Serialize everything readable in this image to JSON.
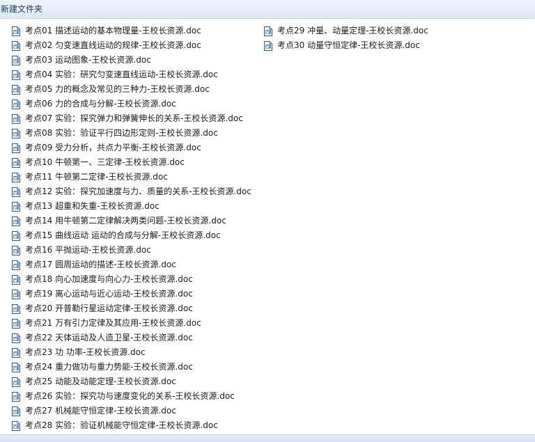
{
  "window": {
    "title": "新建文件夹"
  },
  "icon": {
    "name": "word-document-icon",
    "color": "#2b5797",
    "accent": "#5b8fd6"
  },
  "files_column_1": [
    {
      "name": "考点01 描述运动的基本物理量-王校长资源.doc"
    },
    {
      "name": "考点02 匀变速直线运动的规律-王校长资源.doc"
    },
    {
      "name": "考点03 运动图象-王校长资源.doc"
    },
    {
      "name": "考点04 实验：研究匀变速直线运动-王校长资源.doc"
    },
    {
      "name": "考点05 力的概念及常见的三种力-王校长资源.doc"
    },
    {
      "name": "考点06 力的合成与分解-王校长资源.doc"
    },
    {
      "name": "考点07 实验：探究弹力和弹簧伸长的关系-王校长资源.doc"
    },
    {
      "name": "考点08 实验：验证平行四边形定则-王校长资源.doc"
    },
    {
      "name": "考点09 受力分析，共点力平衡-王校长资源.doc"
    },
    {
      "name": "考点10 牛顿第一、三定律-王校长资源.doc"
    },
    {
      "name": "考点11 牛顿第二定律-王校长资源.doc"
    },
    {
      "name": "考点12 实验：探究加速度与力、质量的关系-王校长资源.doc"
    },
    {
      "name": "考点13 超重和失重-王校长资源.doc"
    },
    {
      "name": "考点14 用牛顿第二定律解决两类问题-王校长资源.doc"
    },
    {
      "name": "考点15 曲线运动  运动的合成与分解-王校长资源.doc"
    },
    {
      "name": "考点16 平抛运动-王校长资源.doc"
    },
    {
      "name": "考点17 圆周运动的描述-王校长资源.doc"
    },
    {
      "name": "考点18 向心加速度与向心力-王校长资源.doc"
    },
    {
      "name": "考点19 离心运动与近心运动-王校长资源.doc"
    },
    {
      "name": "考点20 开普勒行星运动定律-王校长资源.doc"
    },
    {
      "name": "考点21 万有引力定律及其应用-王校长资源.doc"
    },
    {
      "name": "考点22 天体运动及人造卫星-王校长资源.doc"
    },
    {
      "name": "考点23 功 功率-王校长资源.doc"
    },
    {
      "name": "考点24 重力做功与重力势能-王校长资源.doc"
    },
    {
      "name": "考点25 动能及动能定理-王校长资源.doc"
    },
    {
      "name": "考点26 实验：探究功与速度变化的关系-王校长资源.doc"
    },
    {
      "name": "考点27 机械能守恒定律-王校长资源.doc"
    },
    {
      "name": "考点28 实验：验证机械能守恒定律-王校长资源.doc"
    }
  ],
  "files_column_2": [
    {
      "name": "考点29 冲量、动量定理-王校长资源.doc"
    },
    {
      "name": "考点30 动量守恒定律-王校长资源.doc"
    }
  ]
}
